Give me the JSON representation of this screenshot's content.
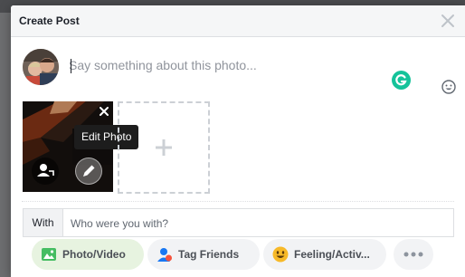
{
  "dialog": {
    "title": "Create Post"
  },
  "composer": {
    "placeholder": "Say something about this photo...",
    "value": ""
  },
  "photo": {
    "tooltip": "Edit Photo"
  },
  "with": {
    "label": "With",
    "placeholder": "Who were you with?"
  },
  "actions": [
    {
      "label": "Photo/Video",
      "icon": "photo-icon",
      "active": true
    },
    {
      "label": "Tag Friends",
      "icon": "tag-friends-icon",
      "active": false
    },
    {
      "label": "Feeling/Activ...",
      "icon": "smiley-icon",
      "active": false
    },
    {
      "label": "",
      "icon": "more-icon",
      "active": false
    }
  ],
  "colors": {
    "header_bg": "#f5f6f7",
    "grammarly": "#15c39a",
    "photo_pill_bg": "#e7f3e0",
    "pill_bg": "#f2f3f5",
    "backdrop": "#6d6e70"
  }
}
